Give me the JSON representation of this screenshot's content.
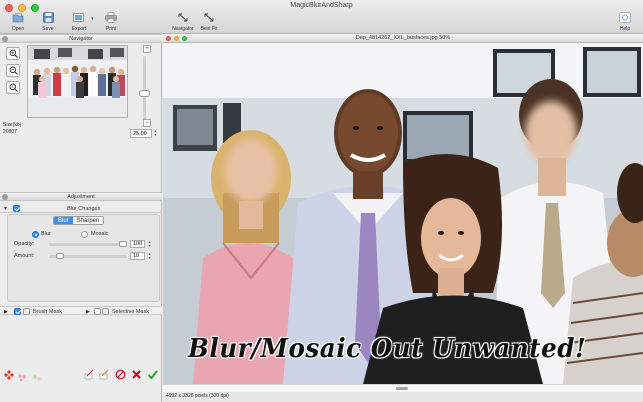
{
  "app": {
    "title": "MagicBlurAndSharp"
  },
  "toolbar": {
    "open": "Open",
    "save": "Save",
    "export": "Export",
    "print": "Print",
    "navigator": "Navigator",
    "best_fit": "Best Fit",
    "help": "Help"
  },
  "navigator": {
    "title": "Navigator",
    "size_label": "Size(kb):",
    "size_value": "20807",
    "zoom_value": "25.00",
    "zoom_slider_level": 0.45
  },
  "adjustment": {
    "title": "Adjustment",
    "blur_changes_label": "Blur Changes",
    "blur_changes_checked": true,
    "tabs": [
      "Blur",
      "Sharpen"
    ],
    "active_tab": "Blur",
    "mode_blur": "Blur",
    "mode_mosaic": "Mosaic",
    "selected_mode": "Blur",
    "opacity_label": "Opacity:",
    "opacity_value": "100",
    "opacity_level": 1.0,
    "amount_label": "Amount:",
    "amount_value": "10",
    "amount_level": 0.1
  },
  "masks": {
    "brush_label": "Brush Mask",
    "brush_checked": true,
    "selective_label": "Selective Mask",
    "selective_checked": false
  },
  "document": {
    "filename": "Dep_4814262_XXL_busfaces.jpg 50%",
    "overlay_caption": "Blur/Mosaic Out Unwanted!",
    "status": "4992 x 3328 pixels (300 dpi)"
  },
  "icons": {
    "open": "open-icon",
    "save": "save-icon",
    "export": "export-icon",
    "print": "print-icon",
    "navigator": "navigator-icon",
    "best_fit": "best-fit-icon",
    "help": "help-icon"
  },
  "colors": {
    "accent": "#3b8ff5",
    "cancel": "#d0021b",
    "confirm": "#2aa52a"
  }
}
